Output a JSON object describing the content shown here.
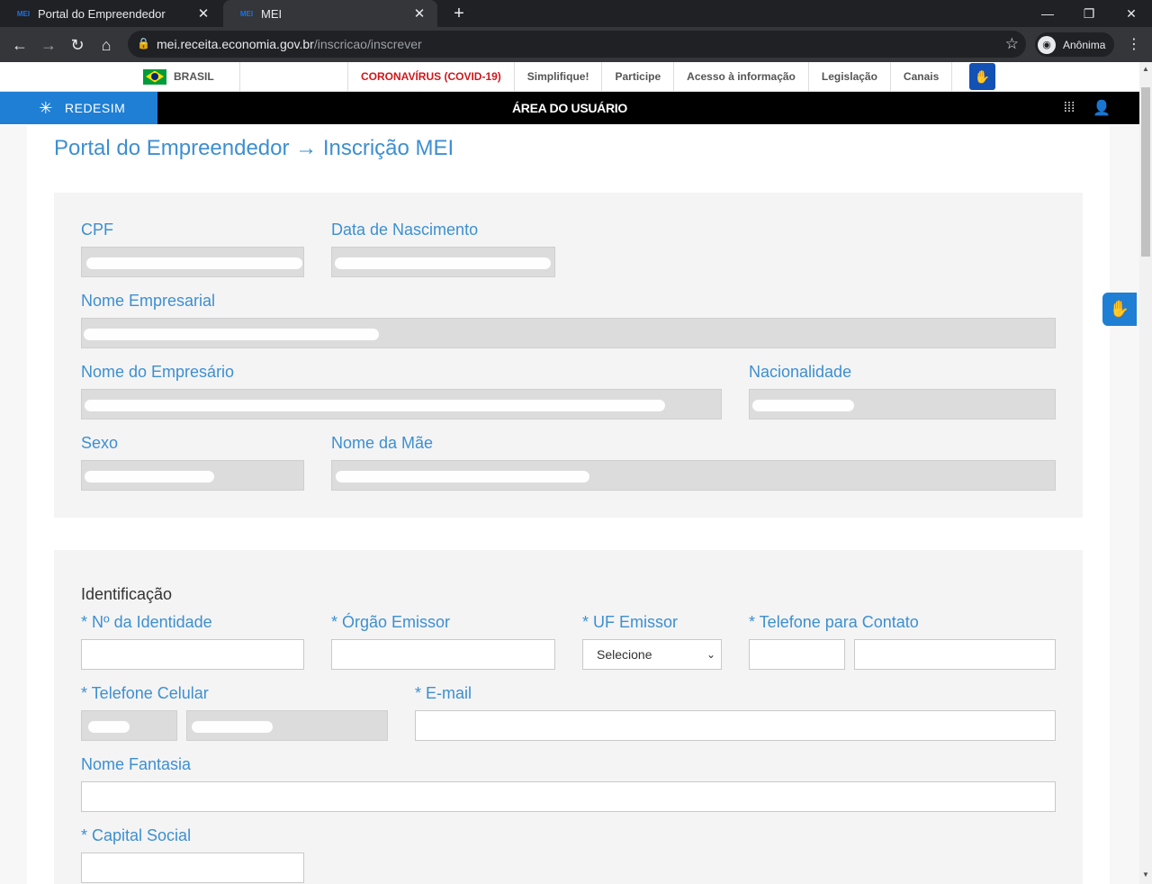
{
  "browser": {
    "tabs": [
      {
        "favicon": "MEI",
        "title": "Portal do Empreendedor"
      },
      {
        "favicon": "MEI",
        "title": "MEI"
      }
    ],
    "url_domain": "mei.receita.economia.gov.br",
    "url_path": "/inscricao/inscrever",
    "profile_label": "Anônima",
    "icons": {
      "back": "←",
      "forward": "→",
      "reload": "↻",
      "home": "⌂",
      "lock": "🔒",
      "star": "☆",
      "close": "✕",
      "new_tab": "+",
      "minimize": "—",
      "restore": "❐",
      "window_close": "✕",
      "menu": "⋮",
      "incognito": "◉"
    }
  },
  "govbar": {
    "country": "BRASIL",
    "links": [
      "CORONAVÍRUS (COVID-19)",
      "Simplifique!",
      "Participe",
      "Acesso à informação",
      "Legislação",
      "Canais"
    ],
    "accent_red": "#d0171b"
  },
  "redesim": {
    "logo_text": "REDESIM",
    "title": "ÁREA DO USUÁRIO",
    "accent_blue": "#1f7fd4"
  },
  "page": {
    "title": "Portal do Empreendedor → Inscrição MEI"
  },
  "personal": {
    "cpf_label": "CPF",
    "birth_label": "Data de Nascimento",
    "company_name_label": "Nome Empresarial",
    "owner_name_label": "Nome do Empresário",
    "nationality_label": "Nacionalidade",
    "sex_label": "Sexo",
    "mother_name_label": "Nome da Mãe"
  },
  "identification": {
    "section_title": "Identificação",
    "id_number_label": "* Nº da Identidade",
    "issuer_label": "* Órgão Emissor",
    "uf_issuer_label": "* UF Emissor",
    "uf_selected": "Selecione",
    "contact_phone_label": "* Telefone para Contato",
    "mobile_label": "* Telefone Celular",
    "email_label": "* E-mail",
    "trade_name_label": "Nome Fantasia",
    "capital_label": "* Capital Social"
  }
}
